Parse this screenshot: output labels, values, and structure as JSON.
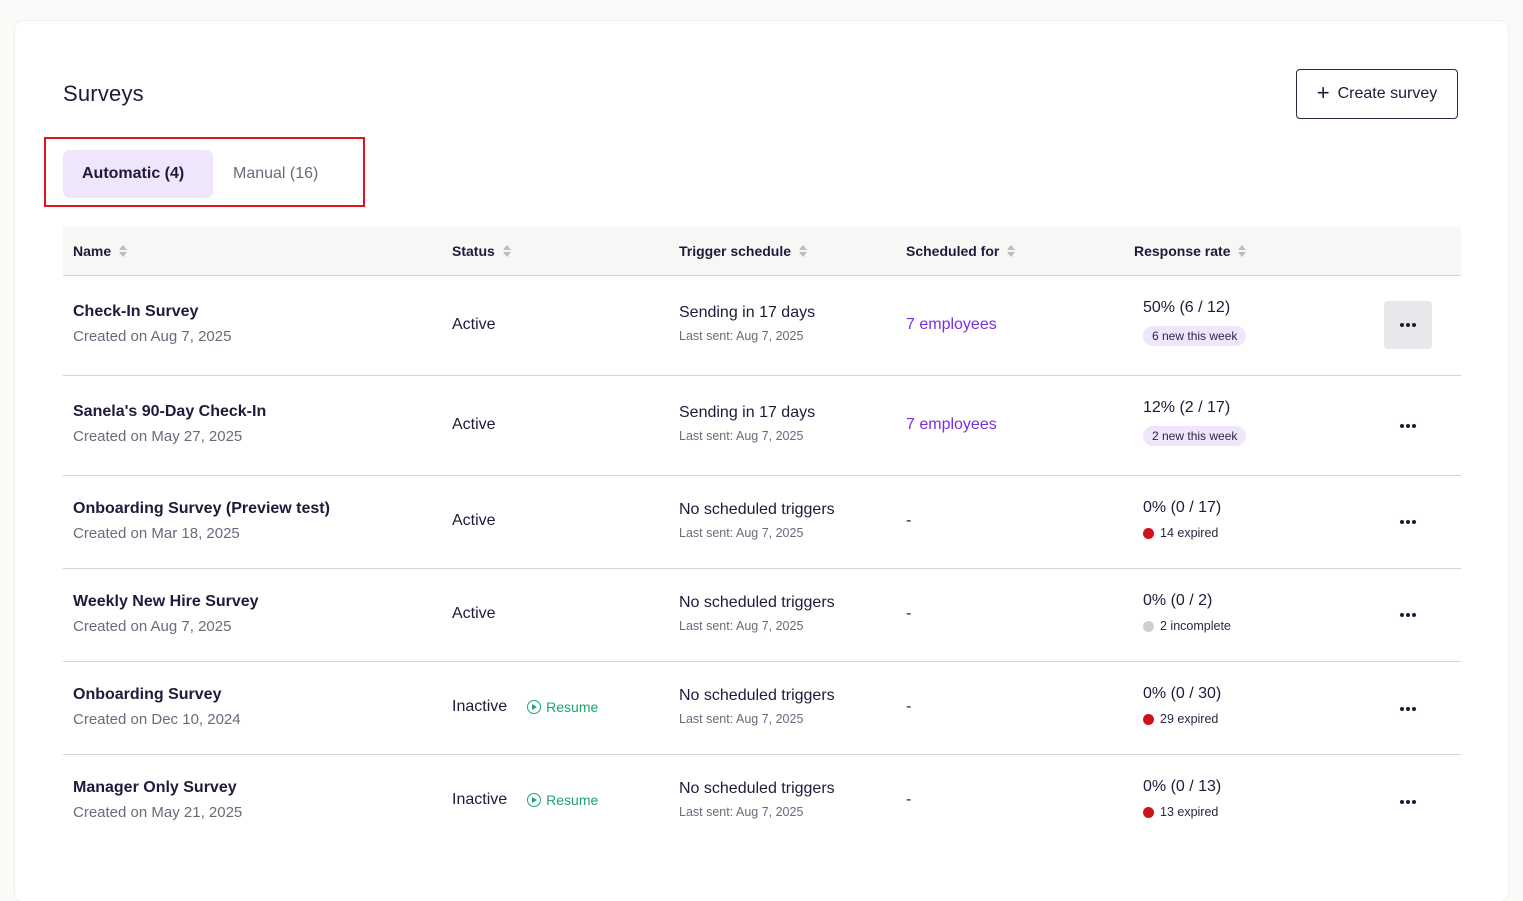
{
  "header": {
    "title": "Surveys",
    "create_label": "Create survey"
  },
  "tabs": [
    {
      "label": "Automatic (4)",
      "active": true
    },
    {
      "label": "Manual (16)",
      "active": false
    }
  ],
  "columns": [
    "Name",
    "Status",
    "Trigger schedule",
    "Scheduled for",
    "Response rate"
  ],
  "colors": {
    "accent": "#7a2ee6",
    "badge_bg": "#efe6fb",
    "resume_green": "#1ea36a",
    "expired_red": "#d0101c",
    "incomplete_gray": "#cfcdd6"
  },
  "rows": [
    {
      "name": "Check-In Survey",
      "created": "Created on Aug 7, 2025",
      "status": "Active",
      "resume": "",
      "trigger": "Sending in 17 days",
      "last_sent": "Last sent: Aug 7, 2025",
      "scheduled": "7 employees",
      "rate": "50% (6 / 12)",
      "badge": "6 new this week",
      "note": "",
      "note_type": ""
    },
    {
      "name": "Sanela's 90-Day Check-In",
      "created": "Created on May 27, 2025",
      "status": "Active",
      "resume": "",
      "trigger": "Sending in 17 days",
      "last_sent": "Last sent: Aug 7, 2025",
      "scheduled": "7 employees",
      "rate": "12% (2 / 17)",
      "badge": "2 new this week",
      "note": "",
      "note_type": ""
    },
    {
      "name": "Onboarding Survey (Preview test)",
      "created": "Created on Mar 18, 2025",
      "status": "Active",
      "resume": "",
      "trigger": "No scheduled triggers",
      "last_sent": "Last sent: Aug 7, 2025",
      "scheduled": "-",
      "rate": "0% (0 / 17)",
      "badge": "",
      "note": "14 expired",
      "note_type": "expired"
    },
    {
      "name": "Weekly New Hire Survey",
      "created": "Created on Aug 7, 2025",
      "status": "Active",
      "resume": "",
      "trigger": "No scheduled triggers",
      "last_sent": "Last sent: Aug 7, 2025",
      "scheduled": "-",
      "rate": "0% (0 / 2)",
      "badge": "",
      "note": "2 incomplete",
      "note_type": "incomplete"
    },
    {
      "name": "Onboarding Survey",
      "created": "Created on Dec 10, 2024",
      "status": "Inactive",
      "resume": "Resume",
      "trigger": "No scheduled triggers",
      "last_sent": "Last sent: Aug 7, 2025",
      "scheduled": "-",
      "rate": "0% (0 / 30)",
      "badge": "",
      "note": "29 expired",
      "note_type": "expired"
    },
    {
      "name": "Manager Only Survey",
      "created": "Created on May 21, 2025",
      "status": "Inactive",
      "resume": "Resume",
      "trigger": "No scheduled triggers",
      "last_sent": "Last sent: Aug 7, 2025",
      "scheduled": "-",
      "rate": "0% (0 / 13)",
      "badge": "",
      "note": "13 expired",
      "note_type": "expired"
    }
  ]
}
